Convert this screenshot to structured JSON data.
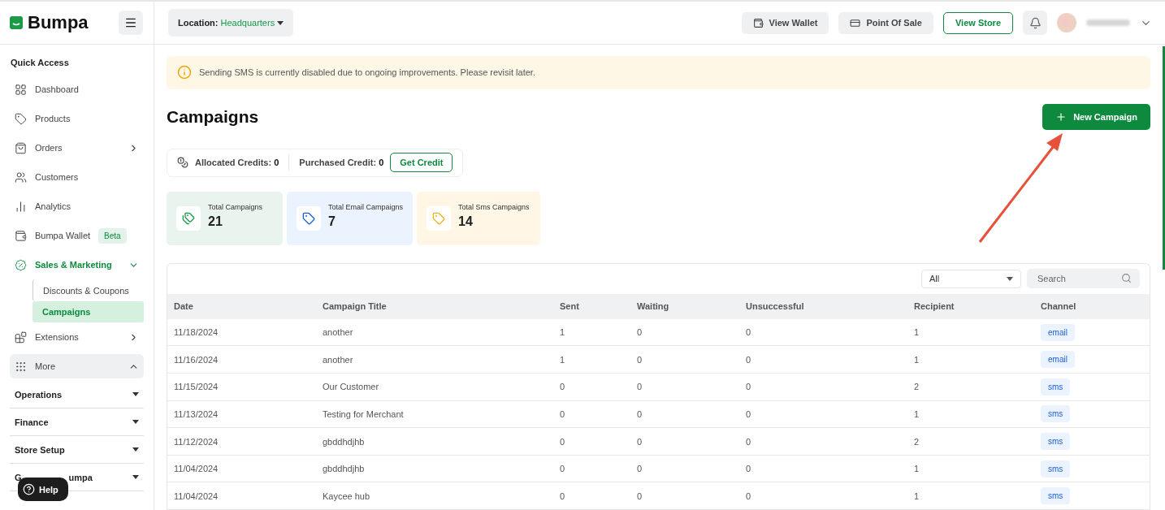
{
  "header": {
    "logo": "Bumpa",
    "location_label": "Location:",
    "location_value": "Headquarters",
    "buttons": [
      {
        "label": "View Wallet",
        "kind": "grey"
      },
      {
        "label": "Point Of Sale",
        "kind": "grey"
      },
      {
        "label": "View Store",
        "kind": "outline"
      }
    ]
  },
  "sidebar": {
    "section_title": "Quick Access",
    "items": [
      {
        "label": "Dashboard",
        "selected": false
      },
      {
        "label": "Products",
        "selected": false
      },
      {
        "label": "Orders",
        "selected": false,
        "expandable": true,
        "expanded": false
      },
      {
        "label": "Customers",
        "selected": false
      },
      {
        "label": "Analytics",
        "selected": false
      },
      {
        "label": "Bumpa Wallet",
        "selected": false,
        "badge": "Beta"
      },
      {
        "label": "Sales & Marketing",
        "selected": true,
        "expandable": true,
        "expanded": true,
        "children": [
          {
            "label": "Discounts & Coupons",
            "selected": false
          },
          {
            "label": "Campaigns",
            "selected": true
          }
        ]
      },
      {
        "label": "Extensions",
        "selected": false,
        "expandable": true,
        "expanded": false
      },
      {
        "label": "More",
        "selected": false,
        "expandable": true,
        "expanded": true,
        "highlighted": true
      }
    ],
    "groups": [
      {
        "label": "Operations"
      },
      {
        "label": "Finance"
      },
      {
        "label": "Store Setup"
      },
      {
        "label_start": "G",
        "label_end": "umpa"
      }
    ],
    "help_button": "Help"
  },
  "notice": "Sending SMS is currently disabled due to ongoing improvements. Please revisit later.",
  "page_title": "Campaigns",
  "new_button": "New Campaign",
  "credits": {
    "allocated_label": "Allocated Credits:",
    "allocated_value": "0",
    "purchased_label": "Purchased Credit:",
    "purchased_value": "0",
    "button": "Get Credit"
  },
  "stats": [
    {
      "label": "Total Campaigns",
      "value": "21",
      "kind": "total"
    },
    {
      "label": "Total Email Campaigns",
      "value": "7",
      "kind": "email"
    },
    {
      "label": "Total Sms Campaigns",
      "value": "14",
      "kind": "sms"
    }
  ],
  "table": {
    "filter": "All",
    "search_placeholder": "Search",
    "columns": [
      "Date",
      "Campaign Title",
      "Sent",
      "Waiting",
      "Unsuccessful",
      "Recipient",
      "Channel"
    ],
    "rows": [
      [
        "11/18/2024",
        "another",
        "1",
        "0",
        "0",
        "1",
        "email"
      ],
      [
        "11/16/2024",
        "another",
        "1",
        "0",
        "0",
        "1",
        "email"
      ],
      [
        "11/15/2024",
        "Our Customer",
        "0",
        "0",
        "0",
        "2",
        "sms"
      ],
      [
        "11/13/2024",
        "Testing for Merchant",
        "0",
        "0",
        "0",
        "1",
        "sms"
      ],
      [
        "11/12/2024",
        "gbddhdjhb",
        "0",
        "0",
        "0",
        "2",
        "sms"
      ],
      [
        "11/04/2024",
        "gbddhdjhb",
        "0",
        "0",
        "0",
        "1",
        "sms"
      ],
      [
        "11/04/2024",
        "Kaycee hub",
        "0",
        "0",
        "0",
        "1",
        "sms"
      ]
    ]
  }
}
